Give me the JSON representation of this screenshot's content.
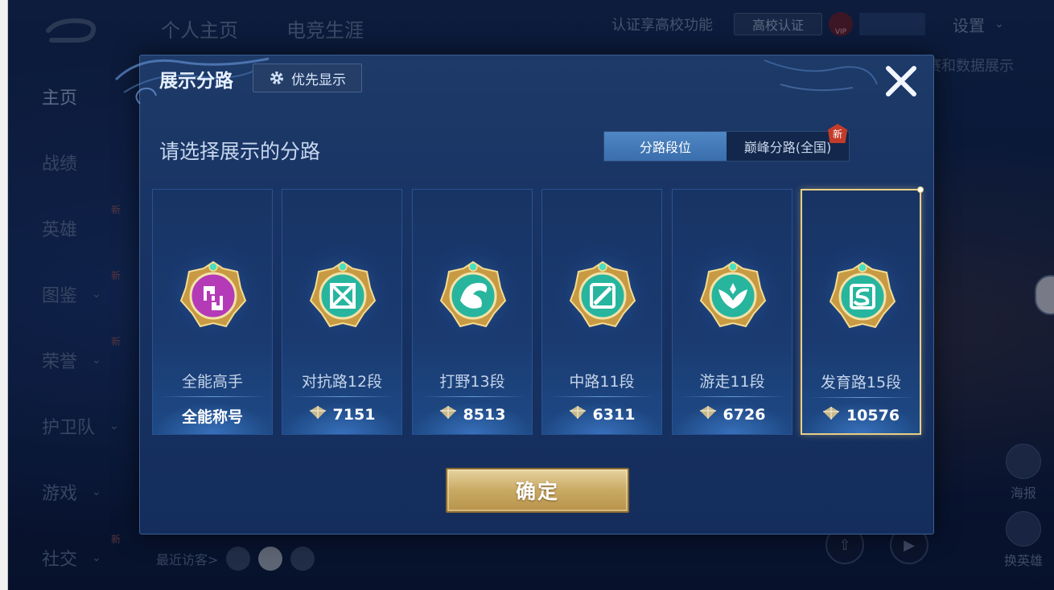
{
  "background": {
    "sidebar": [
      {
        "label": "主页",
        "active": true,
        "chevron": false,
        "new": false
      },
      {
        "label": "战绩",
        "active": false,
        "chevron": false,
        "new": false
      },
      {
        "label": "英雄",
        "active": false,
        "chevron": false,
        "new": true
      },
      {
        "label": "图鉴",
        "active": false,
        "chevron": true,
        "new": true
      },
      {
        "label": "荣誉",
        "active": false,
        "chevron": true,
        "new": true
      },
      {
        "label": "护卫队",
        "active": false,
        "chevron": true,
        "new": false
      },
      {
        "label": "游戏",
        "active": false,
        "chevron": true,
        "new": false
      },
      {
        "label": "社交",
        "active": false,
        "chevron": true,
        "new": true
      }
    ],
    "new_tag": "新",
    "top_tabs": [
      "个人主页",
      "电竞生涯"
    ],
    "top_right": {
      "cert_text": "认证享高校功能",
      "cert_button": "高校认证",
      "vip": "VIP",
      "settings": "设置"
    },
    "caption_right": "赛和数据展示",
    "visitors_label": "最近访客>",
    "right_buttons": [
      "海报",
      "换英雄"
    ]
  },
  "dialog": {
    "title": "展示分路",
    "priority_button": "优先显示",
    "subtitle": "请选择展示的分路",
    "tabs": [
      {
        "label": "分路段位",
        "active": true
      },
      {
        "label": "巅峰分路(全国)",
        "active": false,
        "new": true
      }
    ],
    "tab_new": "新",
    "cards": [
      {
        "name": "全能高手",
        "score": "全能称号",
        "has_icon": false,
        "selected": false,
        "emblem": "allround",
        "color": "#b43ab8"
      },
      {
        "name": "对抗路12段",
        "score": "7151",
        "has_icon": true,
        "selected": false,
        "emblem": "clash",
        "color": "#27b59e"
      },
      {
        "name": "打野13段",
        "score": "8513",
        "has_icon": true,
        "selected": false,
        "emblem": "jungle",
        "color": "#27b59e"
      },
      {
        "name": "中路11段",
        "score": "6311",
        "has_icon": true,
        "selected": false,
        "emblem": "mid",
        "color": "#27b59e"
      },
      {
        "name": "游走11段",
        "score": "6726",
        "has_icon": true,
        "selected": false,
        "emblem": "roam",
        "color": "#27b59e"
      },
      {
        "name": "发育路15段",
        "score": "10576",
        "has_icon": true,
        "selected": true,
        "emblem": "farm",
        "color": "#27b59e"
      }
    ],
    "confirm": "确定"
  }
}
